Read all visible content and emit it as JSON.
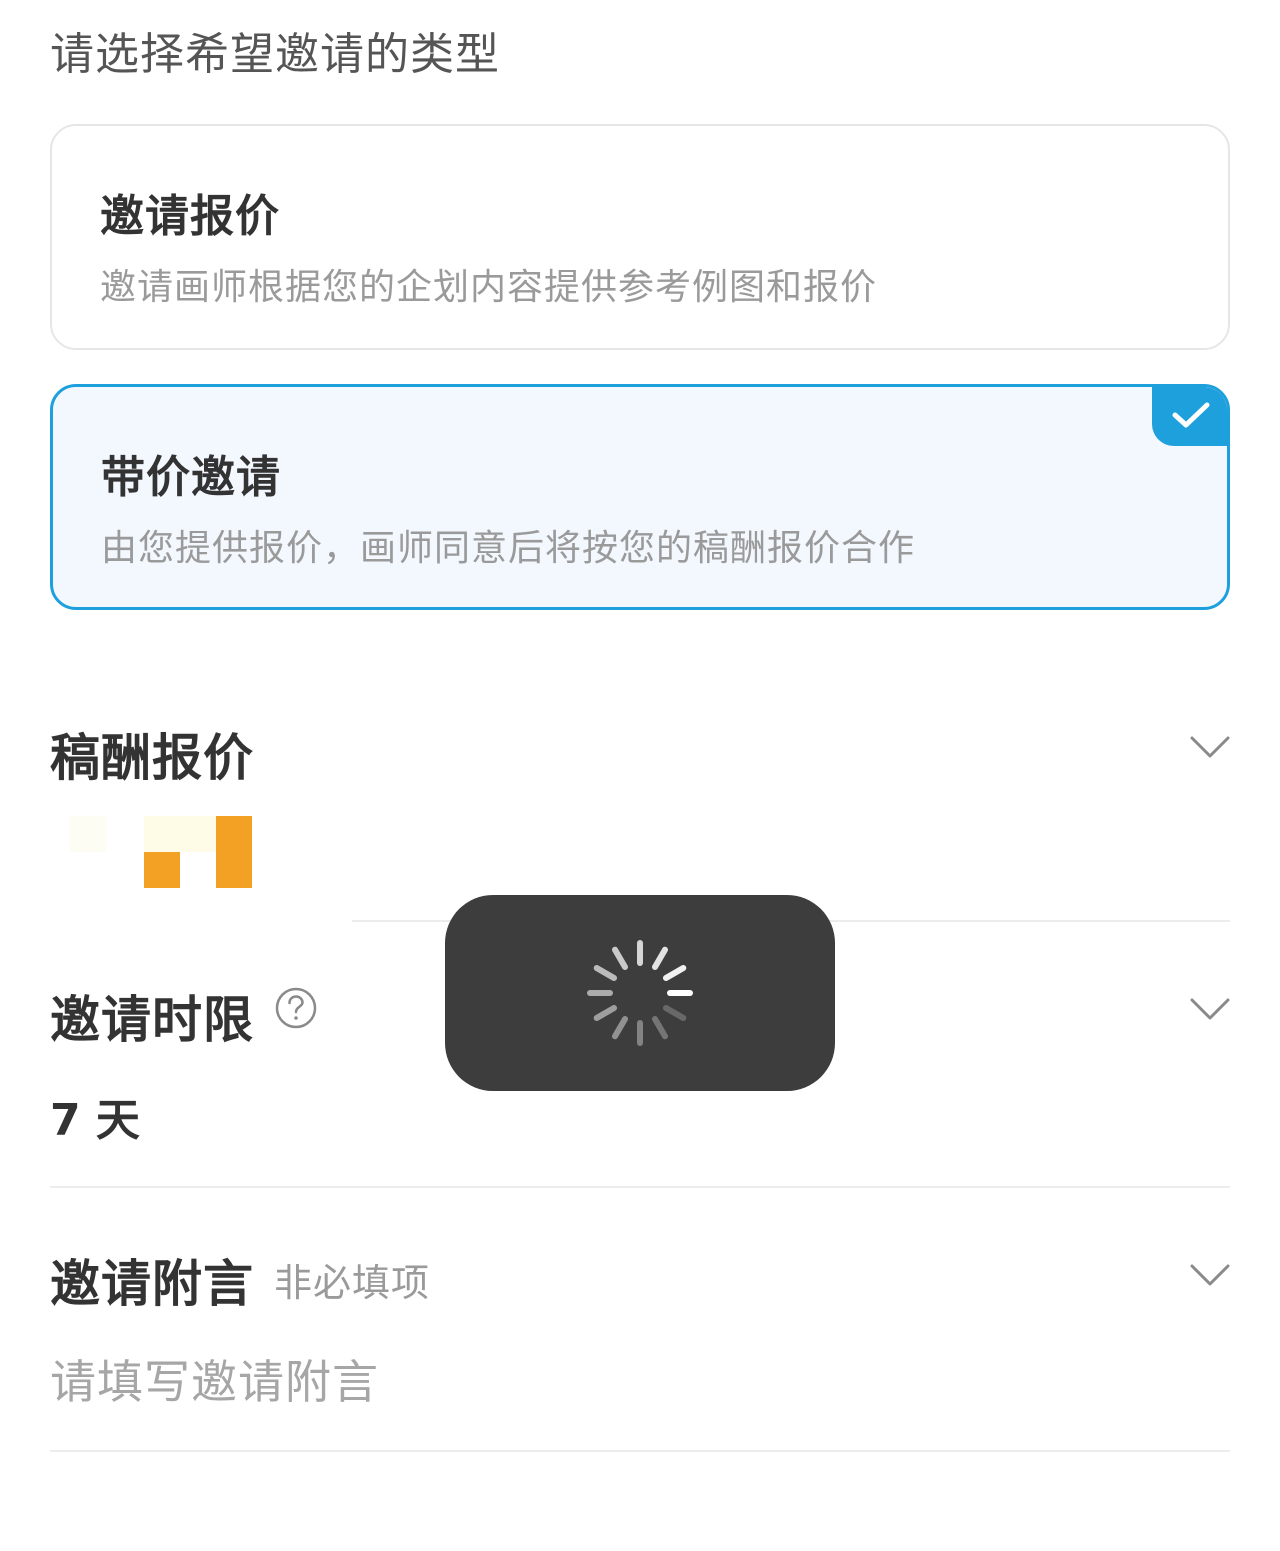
{
  "type_section": {
    "heading": "请选择希望邀请的类型",
    "options": [
      {
        "title": "邀请报价",
        "description": "邀请画师根据您的企划内容提供参考例图和报价",
        "selected": false
      },
      {
        "title": "带价邀请",
        "description": "由您提供报价，画师同意后将按您的稿酬报价合作",
        "selected": true
      }
    ]
  },
  "fee_field": {
    "label": "稿酬报价"
  },
  "deadline_field": {
    "label": "邀请时限",
    "value": "7 天"
  },
  "message_field": {
    "label": "邀请附言",
    "optional_tag": "非必填项",
    "placeholder": "请填写邀请附言"
  },
  "icons": {
    "selected_check": "checkmark-icon",
    "expand": "chevron-down-icon",
    "help": "question-circle-icon",
    "loading": "spinner-icon"
  },
  "colors": {
    "accent": "#1ea0dc",
    "selected_card_bg": "#f3f8ff",
    "toast_bg": "#3d3d3d",
    "price_orange": "#f2a124"
  }
}
